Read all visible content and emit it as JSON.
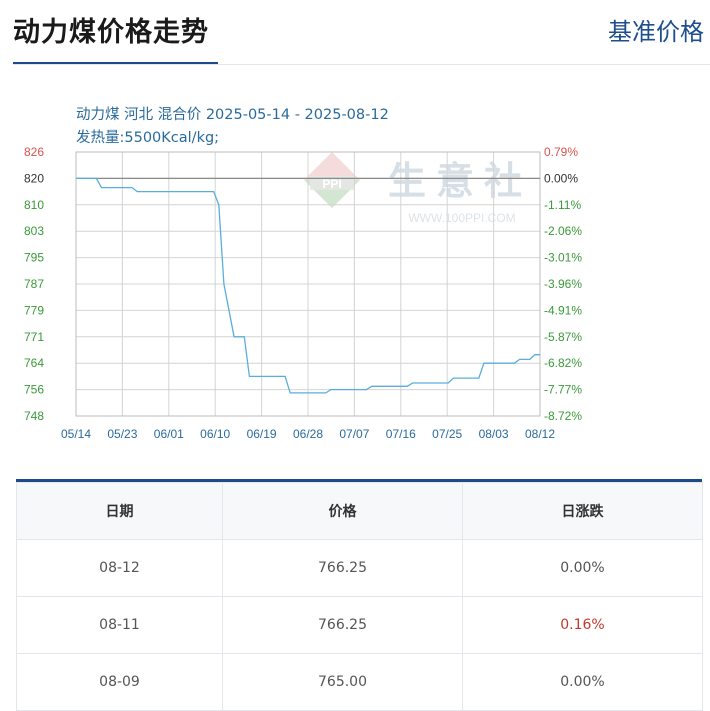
{
  "header": {
    "title": "动力煤价格走势",
    "link_label": "基准价格"
  },
  "chart_data": {
    "type": "line",
    "title": "动力煤 河北 混合价 2025-05-14 - 2025-08-12",
    "subtitle": "发热量:5500Kcal/kg;",
    "watermark": {
      "text": "生意社",
      "url_text": "WWW.100PPI.COM",
      "logo_text": "PPI"
    },
    "left_ticks": [
      "826",
      "820",
      "810",
      "803",
      "795",
      "787",
      "779",
      "771",
      "764",
      "756",
      "748"
    ],
    "right_ticks": [
      "0.79%",
      "0.00%",
      "-1.11%",
      "-2.06%",
      "-3.01%",
      "-3.96%",
      "-4.91%",
      "-5.87%",
      "-6.82%",
      "-7.77%",
      "-8.72%"
    ],
    "x_ticks": [
      "05/14",
      "05/23",
      "06/01",
      "06/10",
      "06/19",
      "06/28",
      "07/07",
      "07/16",
      "07/25",
      "08/03",
      "08/12"
    ],
    "ylim": [
      748,
      826
    ],
    "reference_value": 820,
    "colors": {
      "line": "#5aaedb",
      "grid": "#d4d4d4",
      "left_green": "#3a9a3a",
      "right_green": "#3a9a3a",
      "red": "#d9534f",
      "title": "#2a6b9c"
    },
    "points": [
      {
        "d": 0,
        "v": 820
      },
      {
        "d": 4,
        "v": 820
      },
      {
        "d": 5,
        "v": 816.5
      },
      {
        "d": 11,
        "v": 816.5
      },
      {
        "d": 12,
        "v": 815
      },
      {
        "d": 27,
        "v": 815
      },
      {
        "d": 28,
        "v": 810
      },
      {
        "d": 29,
        "v": 787
      },
      {
        "d": 31,
        "v": 771
      },
      {
        "d": 33,
        "v": 771
      },
      {
        "d": 34,
        "v": 760
      },
      {
        "d": 41,
        "v": 760
      },
      {
        "d": 42,
        "v": 755
      },
      {
        "d": 49,
        "v": 755
      },
      {
        "d": 50,
        "v": 756
      },
      {
        "d": 57,
        "v": 756
      },
      {
        "d": 58,
        "v": 757
      },
      {
        "d": 65,
        "v": 757
      },
      {
        "d": 66,
        "v": 758
      },
      {
        "d": 73,
        "v": 758
      },
      {
        "d": 74,
        "v": 759.5
      },
      {
        "d": 79,
        "v": 759.5
      },
      {
        "d": 80,
        "v": 764
      },
      {
        "d": 86,
        "v": 764
      },
      {
        "d": 87,
        "v": 765
      },
      {
        "d": 89,
        "v": 765
      },
      {
        "d": 90,
        "v": 766.25
      },
      {
        "d": 91,
        "v": 766.25
      }
    ]
  },
  "table": {
    "headers": [
      "日期",
      "价格",
      "日涨跌"
    ],
    "rows": [
      {
        "date": "08-12",
        "price": "766.25",
        "change": "0.00%",
        "up": false
      },
      {
        "date": "08-11",
        "price": "766.25",
        "change": "0.16%",
        "up": true
      },
      {
        "date": "08-09",
        "price": "765.00",
        "change": "0.00%",
        "up": false
      }
    ]
  }
}
